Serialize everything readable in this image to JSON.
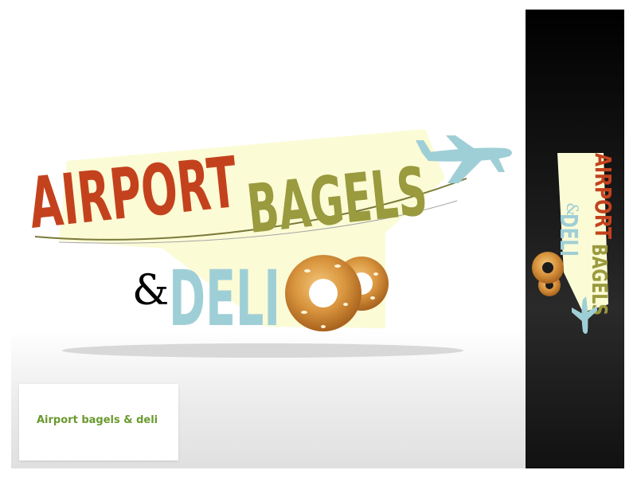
{
  "logo": {
    "word_airport": "AIRPORT",
    "word_bagels": "BAGELS",
    "word_ampersand": "&",
    "word_deli": "DELI"
  },
  "caption": {
    "text": "Airport bagels & deli"
  },
  "colors": {
    "airport_red": "#c3421d",
    "bagels_olive": "#9a9a3e",
    "deli_blue": "#9fcfd6",
    "plane_blue": "#9fcfd6",
    "cream_band": "#fbfbd6",
    "bagel_gold": "#d9953e",
    "caption_green": "#6a9a2e",
    "panel_dark": "#1b1b1b"
  },
  "icons": [
    "airplane-icon",
    "bagel-icon"
  ]
}
